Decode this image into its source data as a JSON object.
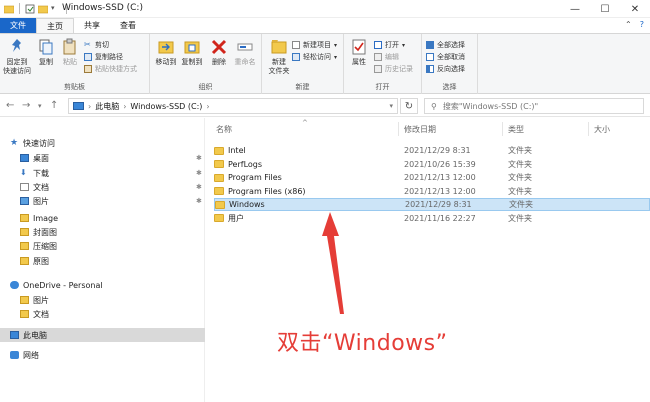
{
  "window": {
    "title": "Windows-SSD (C:)",
    "controls": {
      "minimize": "—",
      "maximize": "☐",
      "close": "✕"
    }
  },
  "ribbon_tabs": [
    "文件",
    "主页",
    "共享",
    "查看"
  ],
  "ribbon": {
    "clipboard": {
      "pin_label": "固定到\n快速访问",
      "copy": "复制",
      "paste": "粘贴",
      "cut": "剪切",
      "copy_path": "复制路径",
      "paste_shortcut": "粘贴快捷方式",
      "group": "剪贴板"
    },
    "organize": {
      "move_to": "移动到",
      "copy_to": "复制到",
      "delete": "删除",
      "rename": "重命名",
      "group": "组织"
    },
    "new": {
      "new_folder": "新建\n文件夹",
      "new_item": "新建项目",
      "easy_access": "轻松访问",
      "group": "新建"
    },
    "open": {
      "properties": "属性",
      "open": "打开",
      "edit": "编辑",
      "history": "历史记录",
      "group": "打开"
    },
    "select": {
      "select_all": "全部选择",
      "select_none": "全部取消",
      "invert": "反向选择",
      "group": "选择"
    }
  },
  "address": {
    "path": [
      "此电脑",
      "Windows-SSD (C:)"
    ],
    "search_placeholder": "搜索\"Windows-SSD (C:)\""
  },
  "nav": {
    "quick_access": "快速访问",
    "items": [
      {
        "label": "桌面",
        "pinned": true,
        "icon": "desktop-icon"
      },
      {
        "label": "下载",
        "pinned": true,
        "icon": "download-icon"
      },
      {
        "label": "文档",
        "pinned": true,
        "icon": "document-icon"
      },
      {
        "label": "图片",
        "pinned": true,
        "icon": "picture-icon"
      },
      {
        "label": "Image",
        "pinned": false,
        "icon": "folder-icon"
      },
      {
        "label": "封面图",
        "pinned": false,
        "icon": "folder-icon"
      },
      {
        "label": "压缩图",
        "pinned": false,
        "icon": "folder-icon"
      },
      {
        "label": "原图",
        "pinned": false,
        "icon": "folder-icon"
      }
    ],
    "onedrive": "OneDrive - Personal",
    "onedrive_items": [
      "图片",
      "文档"
    ],
    "this_pc": "此电脑",
    "network": "网络",
    "pin_glyph": "📌"
  },
  "columns": {
    "name": "名称",
    "modified": "修改日期",
    "type": "类型",
    "size": "大小"
  },
  "files": [
    {
      "name": "Intel",
      "modified": "2021/12/29 8:31",
      "type": "文件夹",
      "selected": false
    },
    {
      "name": "PerfLogs",
      "modified": "2021/10/26 15:39",
      "type": "文件夹",
      "selected": false
    },
    {
      "name": "Program Files",
      "modified": "2021/12/13 12:00",
      "type": "文件夹",
      "selected": false
    },
    {
      "name": "Program Files (x86)",
      "modified": "2021/12/13 12:00",
      "type": "文件夹",
      "selected": false
    },
    {
      "name": "Windows",
      "modified": "2021/12/29 8:31",
      "type": "文件夹",
      "selected": true
    },
    {
      "name": "用户",
      "modified": "2021/11/16 22:27",
      "type": "文件夹",
      "selected": false
    }
  ],
  "annotation": "双击“Windows”",
  "colors": {
    "accent": "#1a67c9",
    "selection_bg": "#cce4f7",
    "annotation": "#e53d37",
    "folder": "#f2c94c"
  }
}
